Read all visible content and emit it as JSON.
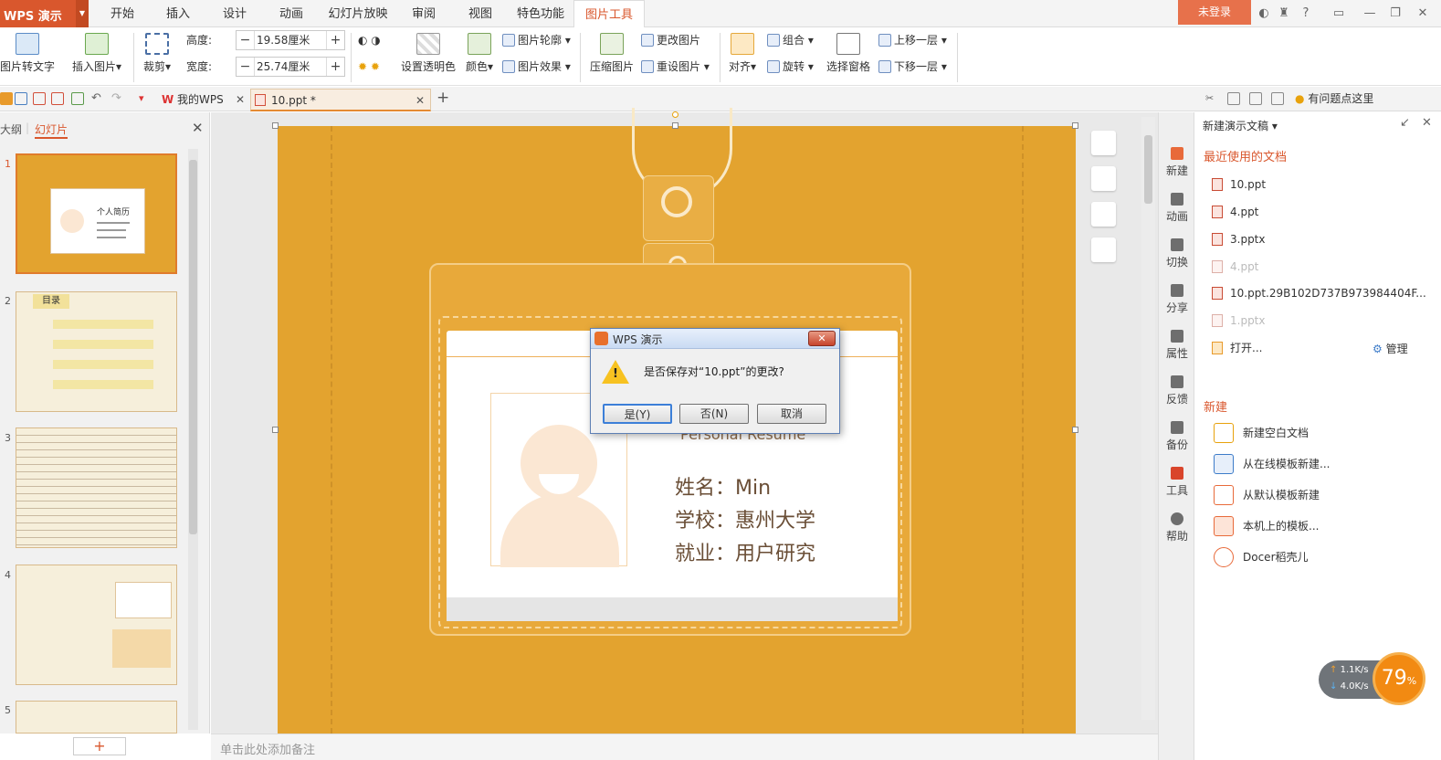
{
  "app": {
    "name": "WPS 演示",
    "login": "未登录"
  },
  "tabs": [
    "开始",
    "插入",
    "设计",
    "动画",
    "幻灯片放映",
    "审阅",
    "视图",
    "特色功能",
    "图片工具"
  ],
  "ribbon": {
    "pic_to_text": "图片转文字",
    "insert_picture": "插入图片",
    "crop": "裁剪",
    "height_label": "高度:",
    "height_value": "19.58厘米",
    "width_label": "宽度:",
    "width_value": "25.74厘米",
    "set_transparent": "设置透明色",
    "color": "颜色",
    "picture_outline": "图片轮廓",
    "picture_effect": "图片效果",
    "compress": "压缩图片",
    "change_picture": "更改图片",
    "reset_picture": "重设图片",
    "align": "对齐",
    "group": "组合",
    "rotate": "旋转",
    "selection_pane": "选择窗格",
    "bring_forward": "上移一层",
    "send_backward": "下移一层"
  },
  "docbar": {
    "tab_mywps": "我的WPS",
    "tab_doc": "10.ppt *",
    "help_text": "有问题点这里"
  },
  "leftpanel": {
    "outline": "大纲",
    "slides": "幻灯片",
    "slide_numbers": [
      "1",
      "2",
      "3",
      "4",
      "5"
    ]
  },
  "thumbs": {
    "t1_title": "个人简历",
    "t2_title": "目录"
  },
  "slide": {
    "subtitle": "Personal Resume",
    "line1": "姓名：Min",
    "line2": "学校：惠州大学",
    "line3": "就业：用户研究"
  },
  "notes": "单击此处添加备注",
  "rightnav": [
    "新建",
    "动画",
    "切换",
    "分享",
    "属性",
    "反馈",
    "备份",
    "工具",
    "帮助"
  ],
  "taskpane": {
    "title": "新建演示文稿",
    "recent_header": "最近使用的文档",
    "recent": [
      "10.ppt",
      "4.ppt",
      "3.pptx",
      "4.ppt",
      "10.ppt.29B102D737B973984404F...",
      "1.pptx"
    ],
    "open": "打开...",
    "manage": "管理",
    "new_header": "新建",
    "new_items": [
      "新建空白文档",
      "从在线模板新建...",
      "从默认模板新建",
      "本机上的模板...",
      "Docer稻壳儿"
    ]
  },
  "dialog": {
    "title": "WPS 演示",
    "message": "是否保存对“10.ppt”的更改?",
    "yes": "是(Y)",
    "no": "否(N)",
    "cancel": "取消"
  },
  "netwidget": {
    "up": "1.1K/s",
    "down": "4.0K/s",
    "percent": "79",
    "unit": "%"
  }
}
